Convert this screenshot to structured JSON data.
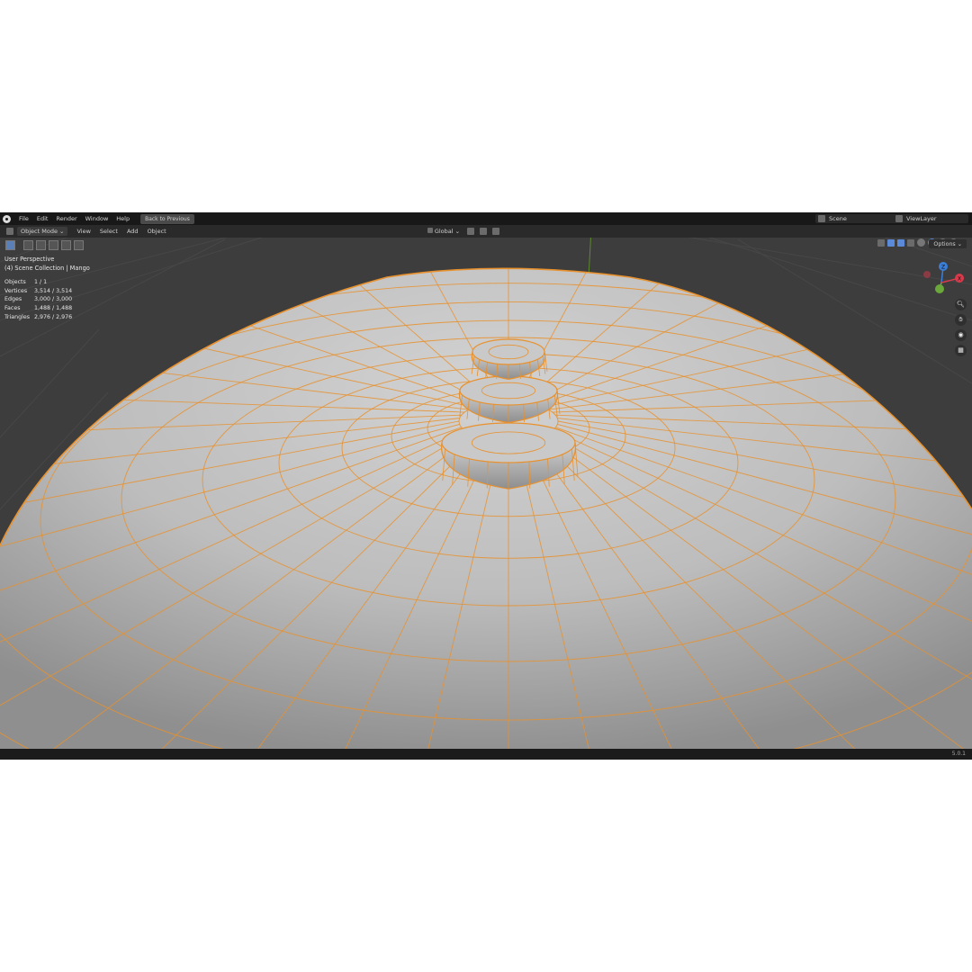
{
  "topbar": {
    "menu": [
      "File",
      "Edit",
      "Render",
      "Window",
      "Help"
    ],
    "back_button": "Back to Previous",
    "scene": "Scene",
    "view_layer": "ViewLayer"
  },
  "header": {
    "mode": "Object Mode",
    "menu": [
      "View",
      "Select",
      "Add",
      "Object"
    ],
    "transform_orientation": "Global"
  },
  "viewport": {
    "perspective": "User Perspective",
    "collection": "(4) Scene Collection | Mango",
    "options_label": "Options",
    "stats": [
      {
        "label": "Objects",
        "value": "1 / 1"
      },
      {
        "label": "Vertices",
        "value": "3,514 / 3,514"
      },
      {
        "label": "Edges",
        "value": "3,000 / 3,000"
      },
      {
        "label": "Faces",
        "value": "1,488 / 1,488"
      },
      {
        "label": "Triangles",
        "value": "2,976 / 2,976"
      }
    ],
    "gizmo": {
      "x": "X",
      "y": "Y",
      "z": "Z"
    }
  },
  "footer": {
    "version": "5.0.1"
  },
  "colors": {
    "background": "#3d3d3d",
    "mesh": "#b9b9b9",
    "wire": "#e8912d",
    "x_axis": "#d83a4b",
    "y_axis": "#6aa83b",
    "z_axis": "#3a7ed8"
  }
}
